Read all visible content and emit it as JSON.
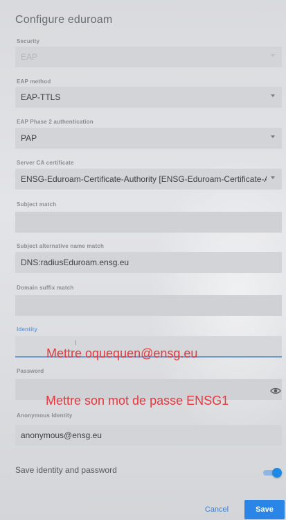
{
  "dialog": {
    "title": "Configure eduroam"
  },
  "fields": {
    "security": {
      "label": "Security",
      "value": "EAP"
    },
    "eap_method": {
      "label": "EAP method",
      "value": "EAP-TTLS"
    },
    "phase2": {
      "label": "EAP Phase 2 authentication",
      "value": "PAP"
    },
    "ca_cert": {
      "label": "Server CA certificate",
      "value": "ENSG-Eduroam-Certificate-Authority [ENSG-Eduroam-Certificate-Autl"
    },
    "subject_match": {
      "label": "Subject match",
      "value": ""
    },
    "san_match": {
      "label": "Subject alternative name match",
      "value": "DNS:radiusEduroam.ensg.eu"
    },
    "domain_suffix": {
      "label": "Domain suffix match",
      "value": ""
    },
    "identity": {
      "label": "Identity",
      "value": ""
    },
    "password": {
      "label": "Password",
      "value": ""
    },
    "anonymous_identity": {
      "label": "Anonymous Identity",
      "value": "anonymous@ensg.eu"
    }
  },
  "annotations": {
    "identity_hint": "Mettre oquequen@ensg.eu",
    "password_hint": "Mettre son mot de passe ENSG1"
  },
  "save_identity": {
    "label": "Save identity and password",
    "enabled": true
  },
  "buttons": {
    "cancel": "Cancel",
    "save": "Save"
  },
  "colors": {
    "accent": "#1e88e5",
    "annotation": "#e8383d",
    "focus_line": "#6e9bd4"
  },
  "icons": {
    "password_toggle": "eye-icon",
    "dropdown": "chevron-down-icon"
  }
}
